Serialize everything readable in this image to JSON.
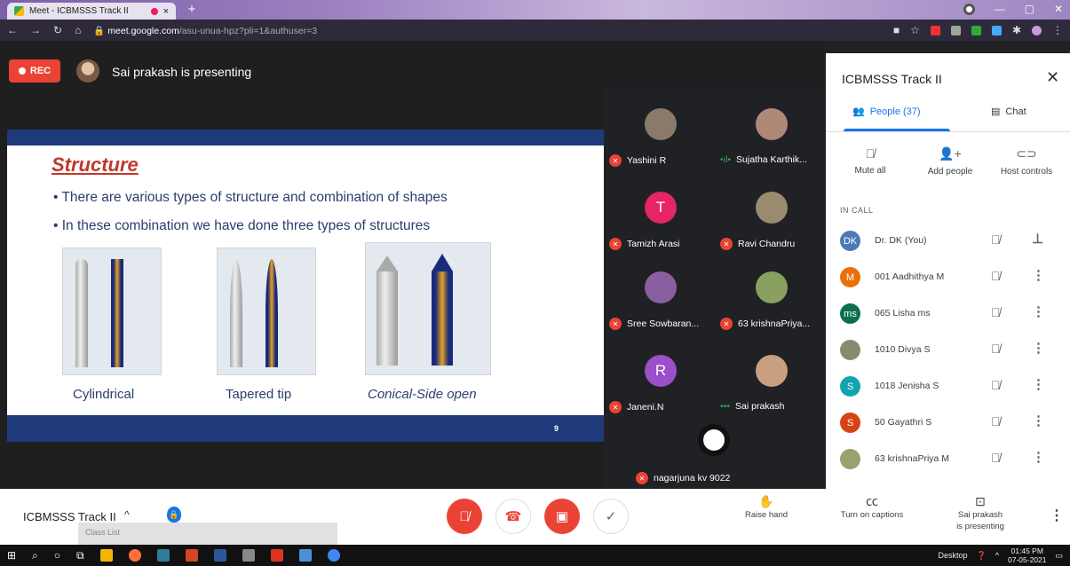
{
  "browser": {
    "tab_title": "Meet - ICBMSSS Track II",
    "tab_close": "×",
    "new_tab": "+",
    "url_host": "meet.google.com",
    "url_path": "/asu-unua-hpz?pli=1&authuser=3"
  },
  "presenting": {
    "rec_label": "REC",
    "text": "Sai prakash is presenting"
  },
  "slide": {
    "title": "Structure",
    "bullets": [
      "There are various types of structure and combination of shapes",
      "In these combination we have done three types of structures"
    ],
    "captions": [
      "Cylindrical",
      "Tapered tip",
      "Conical-Side open"
    ],
    "page_number": "9"
  },
  "tiles": [
    {
      "name": "Yashini R",
      "initial": "",
      "color": "#8a7a6a",
      "muted": true
    },
    {
      "name": "Sujatha Karthik...",
      "initial": "",
      "color": "#b08878",
      "muted": false
    },
    {
      "name": "Tamizh Arasi",
      "initial": "T",
      "color": "#e52565",
      "muted": true
    },
    {
      "name": "Ravi Chandru",
      "initial": "",
      "color": "#9a8a70",
      "muted": true
    },
    {
      "name": "Sree Sowbaran...",
      "initial": "",
      "color": "#8a5fa0",
      "muted": true
    },
    {
      "name": "63 krishnaPriya...",
      "initial": "",
      "color": "#8aa060",
      "muted": true
    },
    {
      "name": "Janeni.N",
      "initial": "R",
      "color": "#9b4fc8",
      "muted": true
    },
    {
      "name": "Sai prakash",
      "initial": "",
      "color": "#c8a080",
      "muted": false
    },
    {
      "name": "nagarjuna kv 9022",
      "initial": "",
      "color": "#fff",
      "muted": true
    }
  ],
  "panel": {
    "title": "ICBMSSS Track II",
    "people_tab": "People (37)",
    "chat_tab": "Chat",
    "mute_all": "Mute all",
    "add_people": "Add people",
    "host_controls": "Host controls",
    "in_call": "IN CALL",
    "participants": [
      {
        "name": "Dr. DK (You)",
        "initial": "DK",
        "color": "#4a7ab5",
        "action": "pin"
      },
      {
        "name": "001 Aadhithya M",
        "initial": "M",
        "color": "#e8710a",
        "action": "more"
      },
      {
        "name": "065 Lisha ms",
        "initial": "ms",
        "color": "#0b6e4f",
        "action": "more"
      },
      {
        "name": "1010 Divya S",
        "initial": "",
        "color": "#8a8a70",
        "action": "more"
      },
      {
        "name": "1018 Jenisha S",
        "initial": "S",
        "color": "#12a4af",
        "action": "more"
      },
      {
        "name": "50 Gayathri S",
        "initial": "S",
        "color": "#d84315",
        "action": "more"
      },
      {
        "name": "63 krishnaPriya M",
        "initial": "",
        "color": "#9aa070",
        "action": "more"
      }
    ]
  },
  "bottom": {
    "meeting_name": "ICBMSSS Track II",
    "class_list": "Class List",
    "raise_hand": "Raise hand",
    "captions": "Turn on captions",
    "presenting_1": "Sai prakash",
    "presenting_2": "is presenting"
  },
  "taskbar": {
    "desktop": "Desktop",
    "time": "01:45 PM",
    "date": "07-05-2021"
  }
}
